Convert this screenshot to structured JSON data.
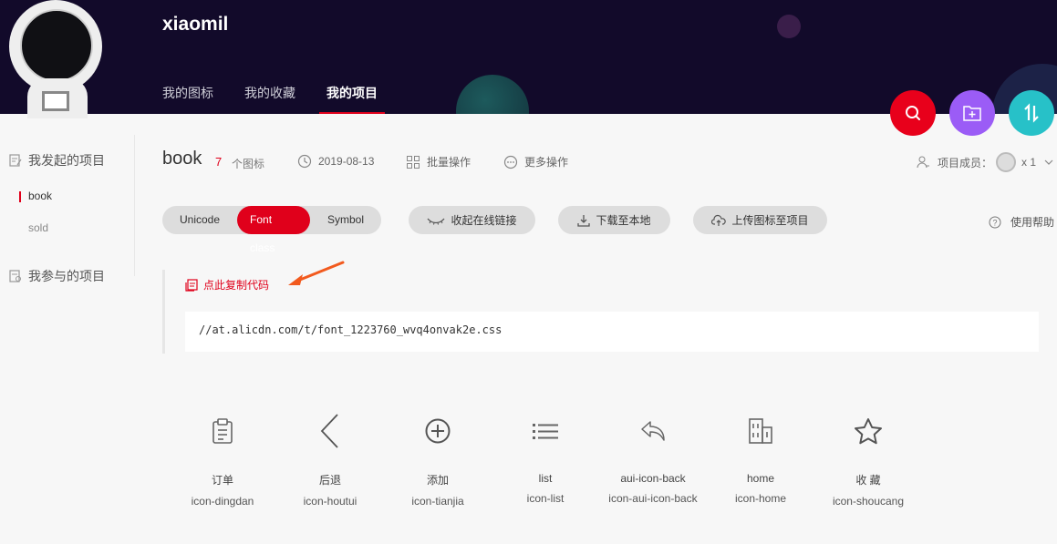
{
  "header": {
    "username": "xiaomil",
    "nav": [
      "我的图标",
      "我的收藏",
      "我的项目"
    ],
    "nav_active": 2
  },
  "sidebar": {
    "group_started": "我发起的项目",
    "projects": [
      "book",
      "sold"
    ],
    "group_joined": "我参与的项目"
  },
  "project": {
    "title": "book",
    "count": "7",
    "count_unit": "个图标",
    "date": "2019-08-13",
    "batch": "批量操作",
    "more": "更多操作",
    "members_label": "项目成员：",
    "members_count": "x 1"
  },
  "toolbar": {
    "tabs": [
      "Unicode",
      "Font class",
      "Symbol"
    ],
    "active_tab": 1,
    "collapse": "收起在线链接",
    "download": "下载至本地",
    "upload": "上传图标至项目",
    "help": "使用帮助"
  },
  "code": {
    "copy_label": "点此复制代码",
    "url": "//at.alicdn.com/t/font_1223760_wvq4onvak2e.css"
  },
  "icons": [
    {
      "icon": "clipboard-icon",
      "name": "订单",
      "class": "icon-dingdan"
    },
    {
      "icon": "back-chevron-icon",
      "name": "后退",
      "class": "icon-houtui"
    },
    {
      "icon": "add-circle-icon",
      "name": "添加",
      "class": "icon-tianjia"
    },
    {
      "icon": "list-icon",
      "name": "list",
      "class": "icon-list"
    },
    {
      "icon": "reply-arrow-icon",
      "name": "aui-icon-back",
      "class": "icon-aui-icon-back"
    },
    {
      "icon": "building-icon",
      "name": "home",
      "class": "icon-home"
    },
    {
      "icon": "star-icon",
      "name": "收 藏",
      "class": "icon-shoucang"
    }
  ],
  "colors": {
    "brand": "#e0001b",
    "header_bg": "#120a2a",
    "fab_search": "#e8001b",
    "fab_add": "#9b5cf6",
    "fab_sort": "#27c1c8"
  }
}
